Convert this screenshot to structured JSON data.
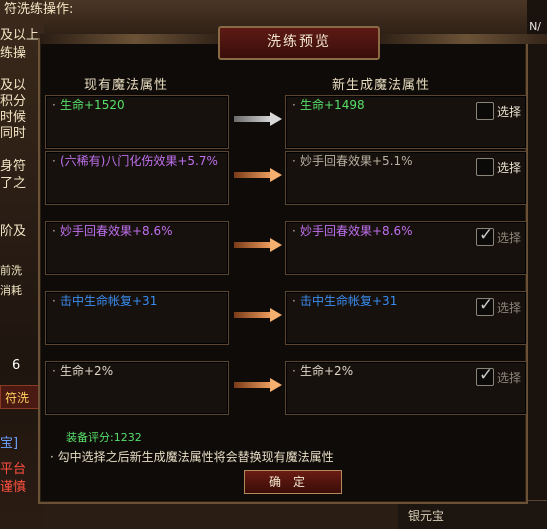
{
  "background": {
    "top_text": "符洗练操作:",
    "left_lines": [
      "及以上",
      "练操",
      "及以",
      "积分",
      "时候",
      "同时",
      "身符",
      "了之",
      "阶及",
      "前洗",
      "消耗",
      "6",
      "符洗",
      "宝]",
      "平台",
      "谨慎"
    ],
    "corner_text": "N/",
    "bottom_right_label": "银元宝"
  },
  "dialog": {
    "title": "洗练预览",
    "left_header": "现有魔法属性",
    "right_header": "新生成魔法属性",
    "select_label": "选择",
    "rows": [
      {
        "current": "生命+1520",
        "current_color": "green",
        "new": "生命+1498",
        "new_color": "green",
        "arrow": "grey",
        "checked": false
      },
      {
        "current": "(六稀有)八门化伤效果+5.7%",
        "current_color": "purple",
        "new": "妙手回春效果+5.1%",
        "new_color": "grey",
        "arrow": "orange",
        "checked": false
      },
      {
        "current": "妙手回春效果+8.6%",
        "current_color": "purple",
        "new": "妙手回春效果+8.6%",
        "new_color": "purple",
        "arrow": "orange",
        "checked": true
      },
      {
        "current": "击中生命帐复+31",
        "current_color": "blue",
        "new": "击中生命帐复+31",
        "new_color": "blue",
        "arrow": "orange",
        "checked": true
      },
      {
        "current": "生命+2%",
        "current_color": "white",
        "new": "生命+2%",
        "new_color": "white",
        "arrow": "orange",
        "checked": true
      }
    ],
    "score_label": "装备评分:1232",
    "note": "勾中选择之后新生成魔法属性将会替换现有魔法属性",
    "confirm_label": "确定"
  },
  "colors": {
    "green": "#58e06a",
    "purple": "#c070f0",
    "blue": "#3a8cf0",
    "white": "#ddd6c8",
    "grey": "#b8b0a2",
    "arrow_orange": "#f5b070",
    "arrow_grey": "#d8d8d8"
  }
}
